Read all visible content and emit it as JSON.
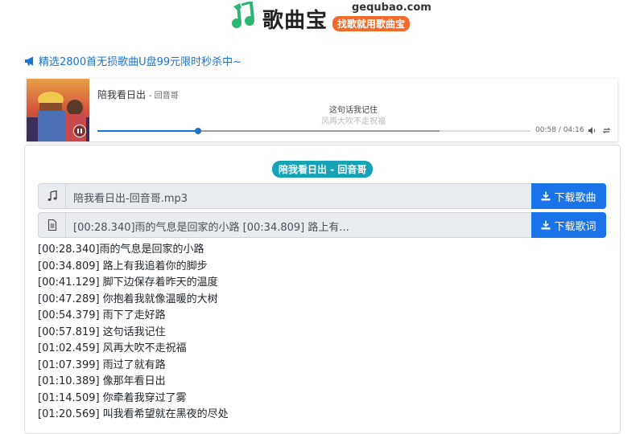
{
  "header": {
    "logo_text": "歌曲宝",
    "domain": "gequbao.com",
    "slogan": "找歌就用歌曲宝"
  },
  "announcement": {
    "text": "精选2800首无损歌曲U盘99元限时秒杀中~"
  },
  "player": {
    "title": "陪我看日出",
    "artist": "- 回音哥",
    "current_lyric": "这句话我记住",
    "next_lyric": "风再大吹不走祝福",
    "time": "00:58 / 04:16",
    "progress_fraction": 0.232,
    "buffered_fraction": 0.79
  },
  "song": {
    "badge": "陪我看日出 - 回音哥",
    "file_name": "陪我看日出-回音哥.mp3",
    "download_song_label": "下载歌曲",
    "lyric_preview": "[00:28.340]雨的气息是回家的小路 [00:34.809] 路上有...",
    "download_lyric_label": "下载歌词"
  },
  "lyrics": [
    "[00:28.340]雨的气息是回家的小路",
    "[00:34.809] 路上有我追着你的脚步",
    "[00:41.129] 脚下边保存着昨天的温度",
    "[00:47.289] 你抱着我就像温暖的大树",
    "[00:54.379] 雨下了走好路",
    "[00:57.819] 这句话我记住",
    "[01:02.459] 风再大吹不走祝福",
    "[01:07.399] 雨过了就有路",
    "[01:10.389] 像那年看日出",
    "[01:14.509] 你牵着我穿过了雾",
    "[01:20.569] 叫我看希望就在黑夜的尽处"
  ],
  "colors": {
    "brand_green": "#2bb673",
    "slogan_orange": "#f26b2a",
    "link_blue": "#1a73c9",
    "badge_teal": "#17a2b8",
    "button_blue": "#1a73e8"
  }
}
